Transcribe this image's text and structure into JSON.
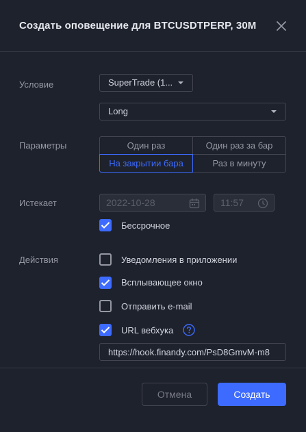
{
  "dialog": {
    "title": "Создать оповещение для BTCUSDTPERP, 30M",
    "close_icon": "close-icon"
  },
  "condition": {
    "label": "Условие",
    "indicator_value": "SuperTrade (1...",
    "signal_value": "Long"
  },
  "params": {
    "label": "Параметры",
    "options": [
      "Один раз",
      "Один раз за бар",
      "На закрытии бара",
      "Раз в минуту"
    ],
    "selected": "На закрытии бара"
  },
  "expires": {
    "label": "Истекает",
    "date_value": "2022-10-28",
    "time_value": "11:57",
    "calendar_icon": "calendar-icon",
    "clock_icon": "clock-icon",
    "open_ended_label": "Бессрочное",
    "open_ended_checked": true
  },
  "actions": {
    "label": "Действия",
    "items": [
      {
        "label": "Уведомления в приложении",
        "checked": false
      },
      {
        "label": "Всплывающее окно",
        "checked": true
      },
      {
        "label": "Отправить e-mail",
        "checked": false
      },
      {
        "label": "URL вебхука",
        "checked": true
      }
    ],
    "help_icon": "help-icon",
    "webhook_url": "https://hook.finandy.com/PsD8GmvM-m8"
  },
  "footer": {
    "cancel_label": "Отмена",
    "create_label": "Создать"
  },
  "colors": {
    "accent": "#3d6bff",
    "background": "#1e222d",
    "border": "#434651"
  }
}
